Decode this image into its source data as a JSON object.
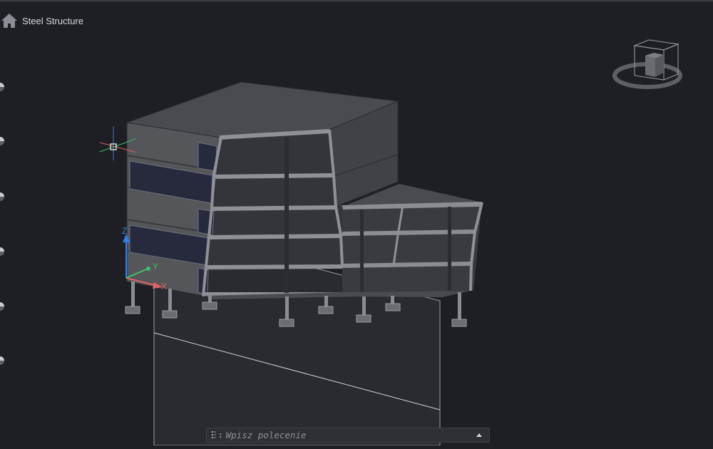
{
  "breadcrumb": {
    "title": "Steel Structure"
  },
  "icons": {
    "home": "home-icon",
    "viewcube": "viewcube-icon",
    "ucs": "ucs-icon",
    "cursor": "crosshair-cursor-icon",
    "command_handle": "grip-icon",
    "command_arrow": "chevron-up-icon"
  },
  "ucs": {
    "x_label": "X",
    "y_label": "Y",
    "z_label": "Z"
  },
  "command_line": {
    "prompt": ":",
    "placeholder": "Wpisz polecenie"
  },
  "colors": {
    "background": "#1e1f24",
    "axis_x": "#e06262",
    "axis_y": "#3fbf6a",
    "axis_z": "#2f7fe8"
  }
}
